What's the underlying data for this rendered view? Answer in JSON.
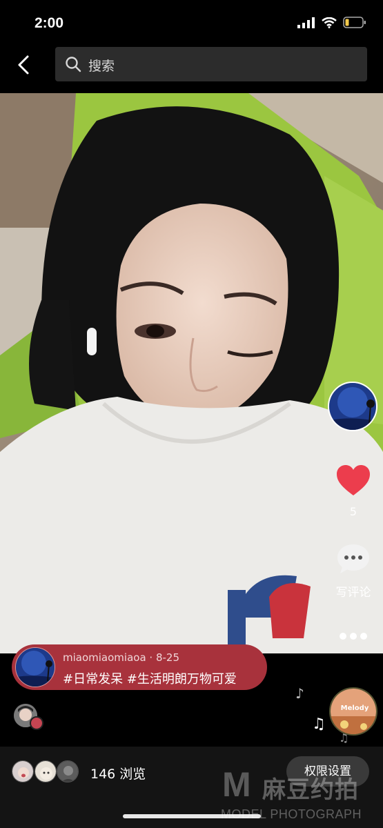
{
  "status_bar": {
    "time": "2:00"
  },
  "search": {
    "placeholder": "搜索"
  },
  "post": {
    "author": "miaomiaomiaoa",
    "date": "8-25",
    "caption": "#日常发呆 #生活明朗万物可爱"
  },
  "actions": {
    "like_count": "5",
    "comment_label": "写评论"
  },
  "music": {
    "disc_label": "Melody"
  },
  "footer": {
    "views": "146 浏览",
    "permission_label": "权限设置"
  },
  "watermark": {
    "brand": "麻豆约拍",
    "sub": "MODEL PHOTOGRAPH",
    "letter": "M"
  },
  "colors": {
    "like": "#ec3d4d",
    "caption_bg": "#a8323c"
  }
}
